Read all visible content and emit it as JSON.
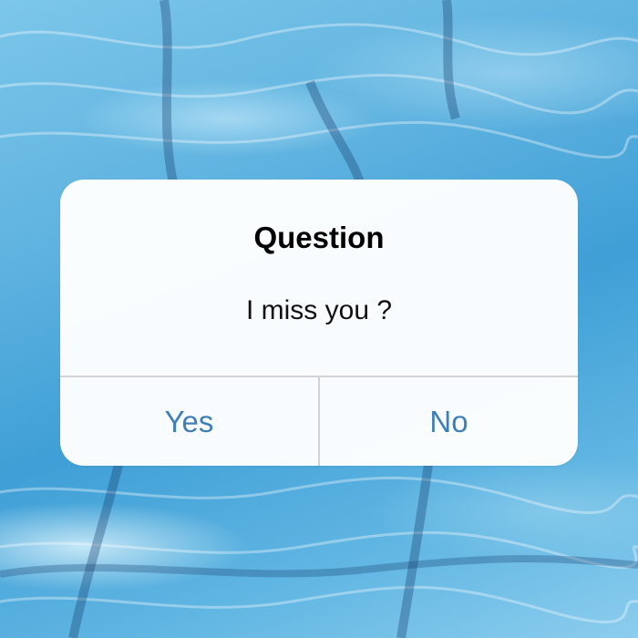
{
  "alert": {
    "title": "Question",
    "message": "I miss you ?",
    "buttons": {
      "yes": "Yes",
      "no": "No"
    }
  },
  "colors": {
    "water": "#4fa9dc",
    "button_text": "#3e7fb8",
    "divider": "#d3d3d6"
  }
}
